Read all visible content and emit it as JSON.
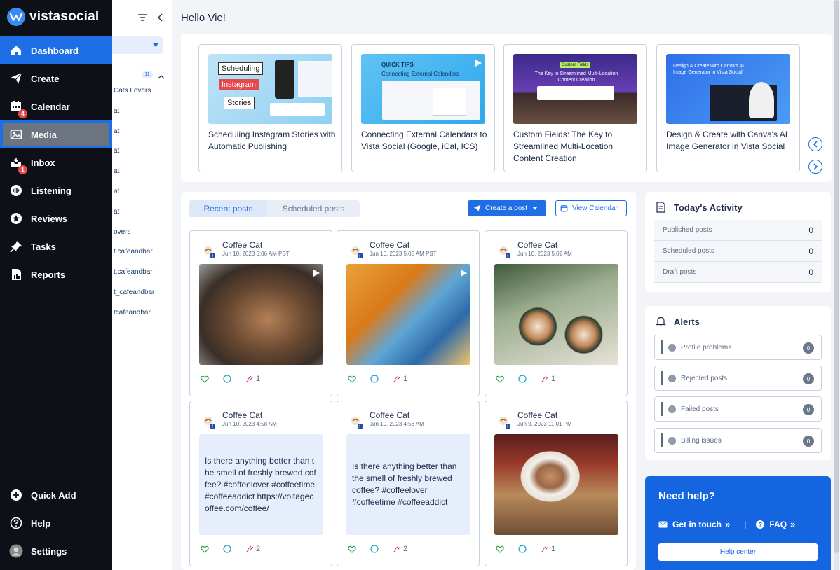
{
  "brand": {
    "name": "vistasocial"
  },
  "nav": [
    {
      "label": "Dashboard",
      "icon": "home-icon"
    },
    {
      "label": "Create",
      "icon": "paper-plane-icon"
    },
    {
      "label": "Calendar",
      "icon": "calendar-icon",
      "badge": "4"
    },
    {
      "label": "Media",
      "icon": "image-icon"
    },
    {
      "label": "Inbox",
      "icon": "inbox-icon",
      "badge": "1"
    },
    {
      "label": "Listening",
      "icon": "soundwave-icon"
    },
    {
      "label": "Reviews",
      "icon": "star-icon"
    },
    {
      "label": "Tasks",
      "icon": "pin-icon"
    },
    {
      "label": "Reports",
      "icon": "report-icon"
    }
  ],
  "bottom_nav": [
    {
      "label": "Quick Add",
      "icon": "plus-circle-icon"
    },
    {
      "label": "Help",
      "icon": "question-icon"
    },
    {
      "label": "Settings",
      "icon": "avatar"
    }
  ],
  "panel": {
    "count": "11",
    "items": [
      "Cats Lovers",
      "at",
      "at",
      "at",
      "at",
      "at",
      "at",
      "overs",
      "t.cafeandbar",
      "t.cafeandbar",
      "t_cafeandbar",
      "tcafeandbar"
    ]
  },
  "greeting": "Hello Vie!",
  "tips": [
    {
      "title": "Scheduling Instagram Stories with Automatic Publishing",
      "thumb_lines": [
        "Scheduling",
        "Instagram",
        "Stories"
      ]
    },
    {
      "title": "Connecting External Calendars to Vista Social (Google, iCal, ICS)",
      "thumb_kicker": "QUICK TIPS",
      "thumb_caption": "Connecting External Calendars"
    },
    {
      "title": "Custom Fields: The Key to Streamlined Multi-Location Content Creation",
      "thumb_tag": "Custom Fields",
      "thumb_caption": "The Key to Streamlined Multi-Location Content Creation"
    },
    {
      "title": "Design & Create with Canva's AI Image Generator in Vista Social",
      "thumb_caption": "Design & Create with Canva's AI Image Generator in Vista Social"
    }
  ],
  "posts_tabs": {
    "recent": "Recent posts",
    "scheduled": "Scheduled posts"
  },
  "buttons": {
    "create_post": "Create a post",
    "view_calendar": "View Calendar"
  },
  "posts": [
    {
      "author": "Coffee Cat",
      "time": "Jun 10, 2023 5:06 AM PST",
      "media": "coffee-pour-over-image",
      "likes": "",
      "comments": "",
      "reach": "1",
      "video": true
    },
    {
      "author": "Coffee Cat",
      "time": "Jun 10, 2023 5:05 AM PST",
      "media": "garfield-cartoon-image",
      "likes": "",
      "comments": "",
      "reach": "1",
      "video": true
    },
    {
      "author": "Coffee Cat",
      "time": "Jun 10, 2023 5:02 AM",
      "media": "latte-art-image",
      "likes": "",
      "comments": "",
      "reach": "1",
      "video": false
    },
    {
      "author": "Coffee Cat",
      "time": "Jun 10, 2023 4:58 AM",
      "text": "Is there anything better than the smell of freshly brewed coffee? #coffeelover #coffeetime #coffeeaddict https://voltagecoffee.com/coffee/",
      "likes": "",
      "comments": "",
      "reach": "2"
    },
    {
      "author": "Coffee Cat",
      "time": "Jun 10, 2023 4:56 AM",
      "text": "Is there anything better than the smell of freshly brewed coffee? #coffeelover #coffeetime #coffeeaddict",
      "likes": "",
      "comments": "",
      "reach": "2"
    },
    {
      "author": "Coffee Cat",
      "time": "Jun 9, 2023 11:01 PM",
      "media": "cappuccino-image",
      "likes": "",
      "comments": "",
      "reach": "1",
      "video": false
    }
  ],
  "activity": {
    "title": "Today's Activity",
    "rows": [
      {
        "label": "Published posts",
        "value": "0"
      },
      {
        "label": "Scheduled posts",
        "value": "0"
      },
      {
        "label": "Draft posts",
        "value": "0"
      }
    ]
  },
  "alerts": {
    "title": "Alerts",
    "rows": [
      {
        "label": "Profile problems",
        "count": "0"
      },
      {
        "label": "Rejected posts",
        "count": "0"
      },
      {
        "label": "Failed posts",
        "count": "0"
      },
      {
        "label": "Billing issues",
        "count": "0"
      }
    ]
  },
  "help": {
    "title": "Need help?",
    "get_in_touch": "Get in touch",
    "faq": "FAQ",
    "help_center": "Help center"
  },
  "colors": {
    "accent": "#1e6fe6",
    "sidebar": "#0d1117",
    "badge": "#e5484d",
    "help_bg": "#1565e0"
  }
}
